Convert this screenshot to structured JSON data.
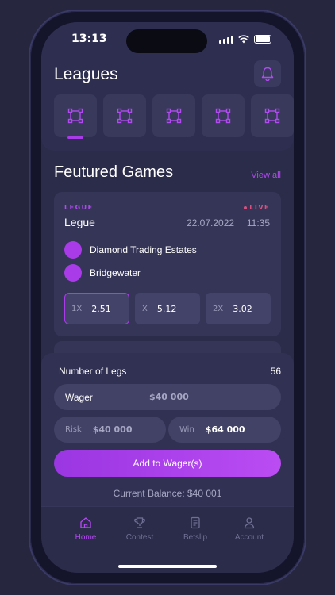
{
  "status_bar": {
    "time": "13:13"
  },
  "leagues": {
    "title": "Leagues",
    "tiles": [
      {
        "icon": "league-icon"
      },
      {
        "icon": "league-icon"
      },
      {
        "icon": "league-icon"
      },
      {
        "icon": "league-icon"
      },
      {
        "icon": "league-icon"
      }
    ]
  },
  "featured": {
    "title": "Feutured Games",
    "view_all": "View all",
    "game": {
      "league_caption": "LEGUE",
      "live_label": "LIVE",
      "league_name": "Legue",
      "date": "22.07.2022",
      "time": "11:35",
      "teams": [
        "Diamond Trading Estates",
        "Bridgewater"
      ],
      "odds": [
        {
          "label": "1X",
          "value": "2.51",
          "selected": true
        },
        {
          "label": "X",
          "value": "5.12",
          "selected": false
        },
        {
          "label": "2X",
          "value": "3.02",
          "selected": false
        }
      ]
    }
  },
  "wager": {
    "legs_label": "Number of Legs",
    "legs_value": "56",
    "wager_label": "Wager",
    "wager_value": "$40 000",
    "risk_label": "Risk",
    "risk_value": "$40 000",
    "win_label": "Win",
    "win_value": "$64 000",
    "add_button": "Add to Wager(s)",
    "balance": "Current Balance: $40 001"
  },
  "tabs": [
    {
      "label": "Home",
      "icon": "home-icon",
      "active": true
    },
    {
      "label": "Contest",
      "icon": "trophy-icon",
      "active": false
    },
    {
      "label": "Betslip",
      "icon": "betslip-icon",
      "active": false
    },
    {
      "label": "Account",
      "icon": "account-icon",
      "active": false
    }
  ],
  "colors": {
    "accent": "#a93be8",
    "live": "#e04e7d",
    "background": "#2b2b4a"
  }
}
